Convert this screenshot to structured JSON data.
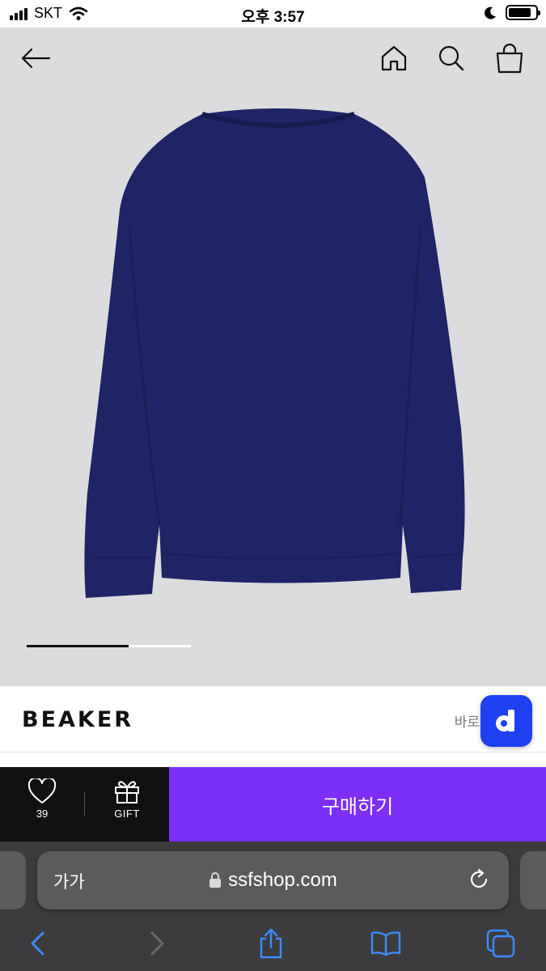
{
  "status_bar": {
    "carrier": "SKT",
    "time": "오후 3:57",
    "battery_level": 0.85
  },
  "hero": {
    "image_indicator_progress": 0.62,
    "icons": [
      "back-arrow-icon",
      "home-icon",
      "search-icon",
      "shopping-bag-icon"
    ],
    "product_color": "#1f2466"
  },
  "brand": {
    "name": "BEAKER",
    "shortcut_label": "바로",
    "floating_button_letter": "d",
    "floating_button_color": "#1e40f0"
  },
  "purchase_bar": {
    "like_count": "39",
    "gift_label": "GIFT",
    "buy_label": "구매하기",
    "buy_color": "#7b2ff7"
  },
  "browser": {
    "text_size_label": "가가",
    "url": "ssfshop.com"
  }
}
